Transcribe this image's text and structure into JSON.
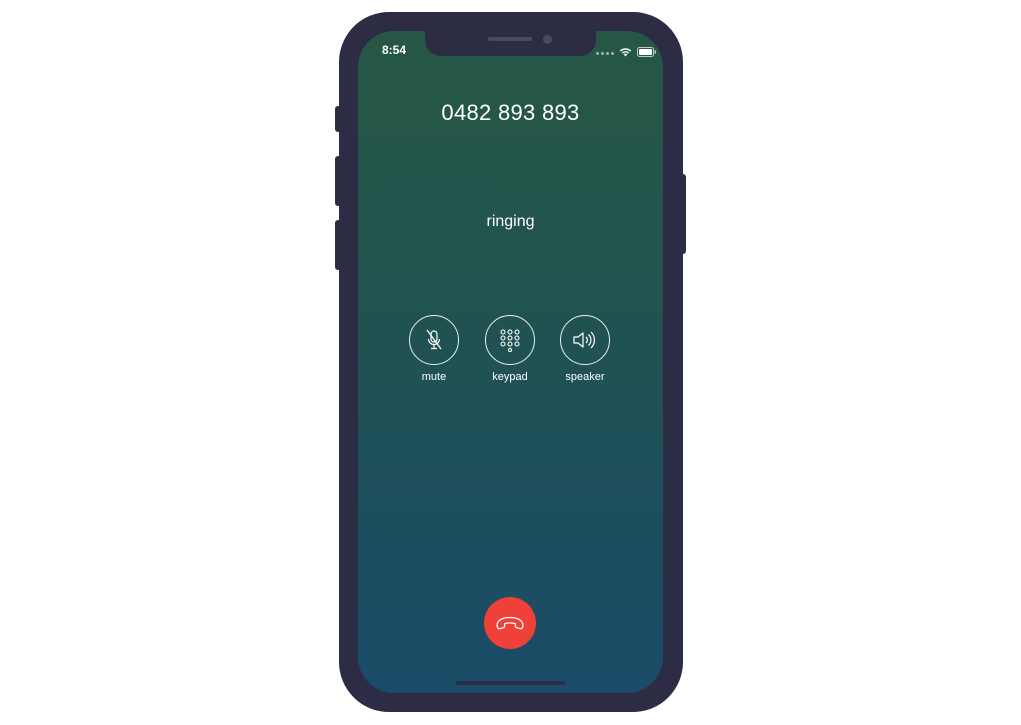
{
  "status_bar": {
    "time": "8:54",
    "icons": [
      "signal-icon",
      "wifi-icon",
      "battery-icon"
    ]
  },
  "call": {
    "number": "0482 893 893",
    "status": "ringing"
  },
  "controls": [
    {
      "label": "mute",
      "icon": "microphone-muted-icon"
    },
    {
      "label": "keypad",
      "icon": "keypad-icon"
    },
    {
      "label": "speaker",
      "icon": "speaker-icon"
    }
  ],
  "end_call": {
    "icon": "hang-up-icon"
  },
  "colors": {
    "frame": "#2c2c44",
    "gradient_top": "#275744",
    "gradient_bottom": "#1a4b68",
    "end_call": "#f0403a",
    "text": "#ffffff"
  }
}
